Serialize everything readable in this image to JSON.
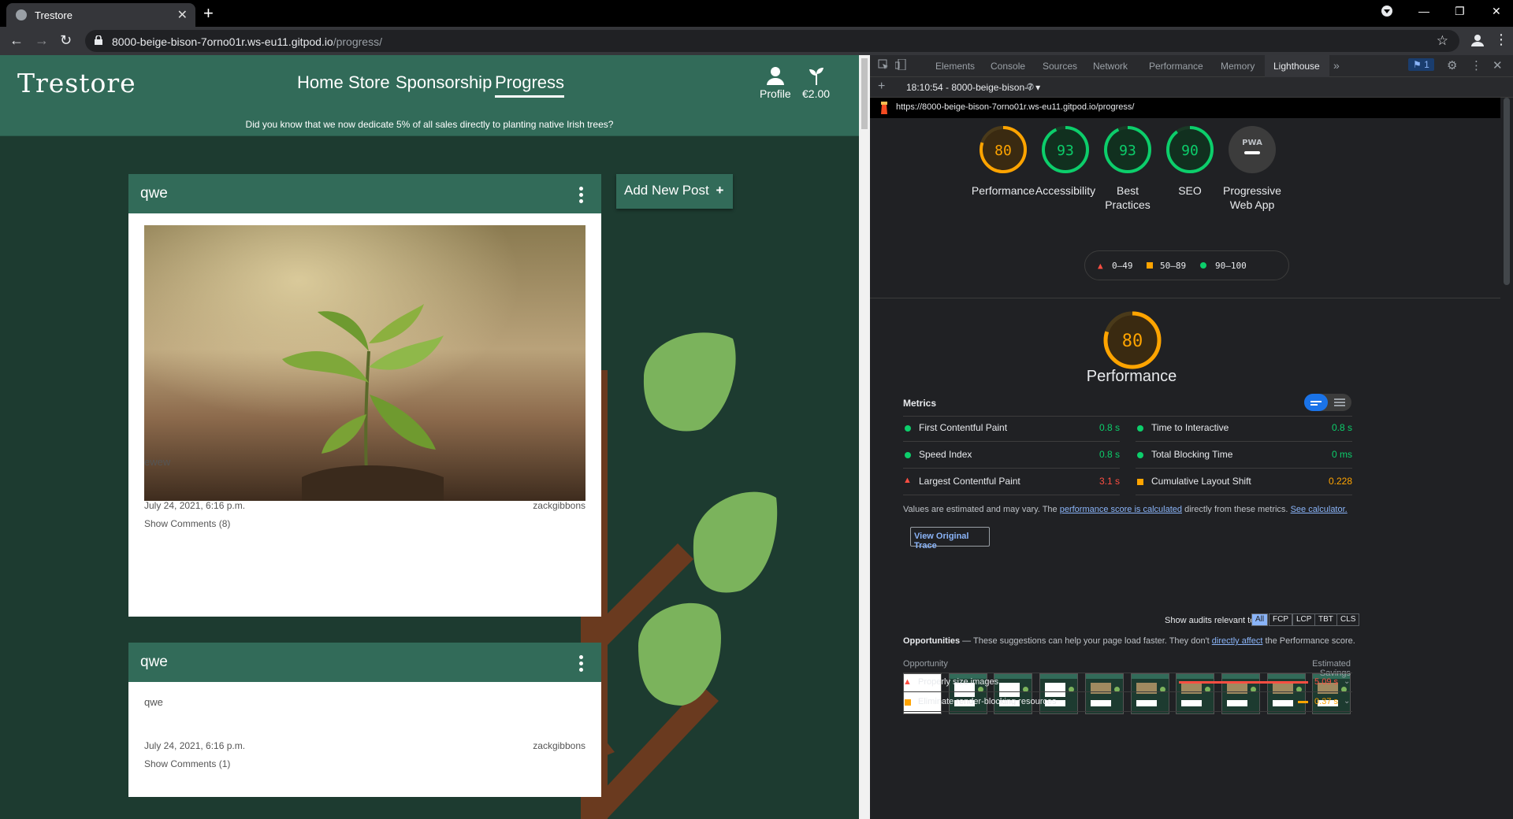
{
  "browser": {
    "tab_title": "Trestore",
    "url_host": "8000-beige-bison-7orno01r.ws-eu11.gitpod.io",
    "url_path": "/progress/"
  },
  "site": {
    "logo": "Trestore",
    "nav": [
      "Home",
      "Store",
      "Sponsorship",
      "Progress"
    ],
    "profile_label": "Profile",
    "balance": "€2.00",
    "banner": "Did you know that we now dedicate 5% of all sales directly to planting native Irish trees?",
    "add_post": "Add New Post",
    "posts": [
      {
        "title": "qwe",
        "body": "ewew",
        "date": "July 24, 2021, 6:16 p.m.",
        "author": "zackgibbons",
        "comments": "Show Comments (8)"
      },
      {
        "title": "qwe",
        "body": "qwe",
        "date": "July 24, 2021, 6:16 p.m.",
        "author": "zackgibbons",
        "comments": "Show Comments (1)"
      }
    ]
  },
  "devtools": {
    "tabs": [
      "Elements",
      "Console",
      "Sources",
      "Network",
      "Performance",
      "Memory",
      "Lighthouse"
    ],
    "issues_count": "1",
    "report_selector": "18:10:54 - 8000-beige-bison-7",
    "report_url": "https://8000-beige-bison-7orno01r.ws-eu11.gitpod.io/progress/",
    "scores": [
      {
        "value": "80",
        "label": "Performance",
        "color": "#ffa400"
      },
      {
        "value": "93",
        "label": "Accessibility",
        "color": "#0cce6b"
      },
      {
        "value": "93",
        "label": "Best Practices",
        "color": "#0cce6b"
      },
      {
        "value": "90",
        "label": "SEO",
        "color": "#0cce6b"
      }
    ],
    "pwa_label": "Progressive Web App",
    "pwa_badge": "PWA",
    "legend": [
      "0–49",
      "50–89",
      "90–100"
    ],
    "perf_score": "80",
    "perf_title": "Performance",
    "metrics_heading": "Metrics",
    "metrics": [
      {
        "name": "First Contentful Paint",
        "value": "0.8 s",
        "status": "pass"
      },
      {
        "name": "Time to Interactive",
        "value": "0.8 s",
        "status": "pass"
      },
      {
        "name": "Speed Index",
        "value": "0.8 s",
        "status": "pass"
      },
      {
        "name": "Total Blocking Time",
        "value": "0 ms",
        "status": "pass"
      },
      {
        "name": "Largest Contentful Paint",
        "value": "3.1 s",
        "status": "fail"
      },
      {
        "name": "Cumulative Layout Shift",
        "value": "0.228",
        "status": "average"
      }
    ],
    "note_a": "Values are estimated and may vary. The ",
    "note_link1": "performance score is calculated",
    "note_b": " directly from these metrics. ",
    "note_link2": "See calculator.",
    "view_trace": "View Original Trace",
    "show_audits": "Show audits relevant to:",
    "audit_chips": [
      "All",
      "FCP",
      "LCP",
      "TBT",
      "CLS"
    ],
    "opps_title": "Opportunities",
    "opps_desc_a": " — These suggestions can help your page load faster. They don't ",
    "opps_link": "directly affect",
    "opps_desc_b": " the Performance score.",
    "opp_col": "Opportunity",
    "savings_col": "Estimated Savings",
    "opportunities": [
      {
        "name": "Properly size images",
        "value": "5.09 s",
        "status": "fail",
        "bar_fraction": 1.0
      },
      {
        "name": "Eliminate render-blocking resources",
        "value": "0.37 s",
        "status": "average",
        "bar_fraction": 0.08
      }
    ]
  }
}
